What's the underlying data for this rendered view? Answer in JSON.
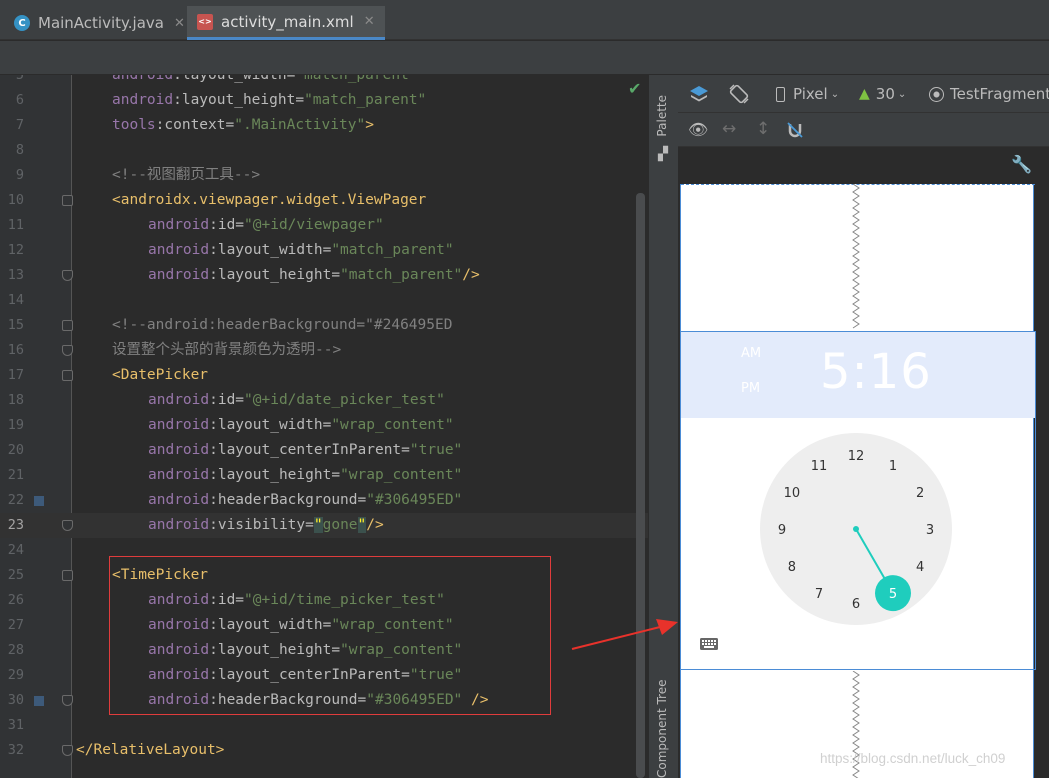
{
  "tabs": [
    {
      "label": "MainActivity.java",
      "icon": "java-class-icon",
      "active": false
    },
    {
      "label": "activity_main.xml",
      "icon": "xml-layout-icon",
      "active": true
    }
  ],
  "editor": {
    "lines": [
      {
        "num": "5",
        "indent": 1,
        "current": false,
        "parts": [
          {
            "c": "an",
            "t": "android"
          },
          {
            "c": "ak",
            "t": ":layout_width="
          },
          {
            "c": "av",
            "t": "\"match_parent\""
          }
        ]
      },
      {
        "num": "6",
        "indent": 1,
        "current": false,
        "parts": [
          {
            "c": "an",
            "t": "android"
          },
          {
            "c": "ak",
            "t": ":layout_height="
          },
          {
            "c": "av",
            "t": "\"match_parent\""
          }
        ]
      },
      {
        "num": "7",
        "indent": 1,
        "current": false,
        "parts": [
          {
            "c": "an",
            "t": "tools"
          },
          {
            "c": "ak",
            "t": ":context="
          },
          {
            "c": "av",
            "t": "\".MainActivity\""
          },
          {
            "c": "tg",
            "t": ">"
          }
        ]
      },
      {
        "num": "8",
        "indent": 0,
        "current": false,
        "parts": []
      },
      {
        "num": "9",
        "indent": 1,
        "current": false,
        "parts": [
          {
            "c": "cm",
            "t": "<!--视图翻页工具-->"
          }
        ]
      },
      {
        "num": "10",
        "indent": 1,
        "current": false,
        "fold": "open",
        "parts": [
          {
            "c": "tg",
            "t": "<androidx.viewpager.widget.ViewPager"
          }
        ]
      },
      {
        "num": "11",
        "indent": 2,
        "current": false,
        "parts": [
          {
            "c": "an",
            "t": "android"
          },
          {
            "c": "ak",
            "t": ":id="
          },
          {
            "c": "av",
            "t": "\"@+id/viewpager\""
          }
        ]
      },
      {
        "num": "12",
        "indent": 2,
        "current": false,
        "parts": [
          {
            "c": "an",
            "t": "android"
          },
          {
            "c": "ak",
            "t": ":layout_width="
          },
          {
            "c": "av",
            "t": "\"match_parent\""
          }
        ]
      },
      {
        "num": "13",
        "indent": 2,
        "current": false,
        "fold": "close",
        "parts": [
          {
            "c": "an",
            "t": "android"
          },
          {
            "c": "ak",
            "t": ":layout_height="
          },
          {
            "c": "av",
            "t": "\"match_parent\""
          },
          {
            "c": "tg",
            "t": "/>"
          }
        ]
      },
      {
        "num": "14",
        "indent": 0,
        "current": false,
        "parts": []
      },
      {
        "num": "15",
        "indent": 1,
        "current": false,
        "fold": "open",
        "parts": [
          {
            "c": "cm",
            "t": "<!--android:headerBackground=\"#246495ED"
          }
        ]
      },
      {
        "num": "16",
        "indent": 1,
        "current": false,
        "fold": "close",
        "parts": [
          {
            "c": "cm",
            "t": "设置整个头部的背景颜色为透明-->"
          }
        ]
      },
      {
        "num": "17",
        "indent": 1,
        "current": false,
        "fold": "open",
        "parts": [
          {
            "c": "tg",
            "t": "<DatePicker"
          }
        ]
      },
      {
        "num": "18",
        "indent": 2,
        "current": false,
        "parts": [
          {
            "c": "an",
            "t": "android"
          },
          {
            "c": "ak",
            "t": ":id="
          },
          {
            "c": "av",
            "t": "\"@+id/date_picker_test\""
          }
        ]
      },
      {
        "num": "19",
        "indent": 2,
        "current": false,
        "parts": [
          {
            "c": "an",
            "t": "android"
          },
          {
            "c": "ak",
            "t": ":layout_width="
          },
          {
            "c": "av",
            "t": "\"wrap_content\""
          }
        ]
      },
      {
        "num": "20",
        "indent": 2,
        "current": false,
        "parts": [
          {
            "c": "an",
            "t": "android"
          },
          {
            "c": "ak",
            "t": ":layout_centerInParent="
          },
          {
            "c": "av",
            "t": "\"true\""
          }
        ]
      },
      {
        "num": "21",
        "indent": 2,
        "current": false,
        "parts": [
          {
            "c": "an",
            "t": "android"
          },
          {
            "c": "ak",
            "t": ":layout_height="
          },
          {
            "c": "av",
            "t": "\"wrap_content\""
          }
        ]
      },
      {
        "num": "22",
        "indent": 2,
        "current": false,
        "marker": true,
        "parts": [
          {
            "c": "an",
            "t": "android"
          },
          {
            "c": "ak",
            "t": ":headerBackground="
          },
          {
            "c": "av",
            "t": "\"#306495ED\""
          }
        ]
      },
      {
        "num": "23",
        "indent": 2,
        "current": true,
        "fold": "close",
        "parts": [
          {
            "c": "an",
            "t": "android"
          },
          {
            "c": "ak",
            "t": ":visibility="
          },
          {
            "c": "hl",
            "t": "\""
          },
          {
            "c": "av",
            "t": "gone"
          },
          {
            "c": "hl",
            "t": "\""
          },
          {
            "c": "tg",
            "t": "/>"
          }
        ]
      },
      {
        "num": "24",
        "indent": 0,
        "current": false,
        "parts": []
      },
      {
        "num": "25",
        "indent": 1,
        "current": false,
        "fold": "open",
        "parts": [
          {
            "c": "tg",
            "t": "<TimePicker"
          }
        ]
      },
      {
        "num": "26",
        "indent": 2,
        "current": false,
        "parts": [
          {
            "c": "an",
            "t": "android"
          },
          {
            "c": "ak",
            "t": ":id="
          },
          {
            "c": "av",
            "t": "\"@+id/time_picker_test\""
          }
        ]
      },
      {
        "num": "27",
        "indent": 2,
        "current": false,
        "parts": [
          {
            "c": "an",
            "t": "android"
          },
          {
            "c": "ak",
            "t": ":layout_width="
          },
          {
            "c": "av",
            "t": "\"wrap_content\""
          }
        ]
      },
      {
        "num": "28",
        "indent": 2,
        "current": false,
        "parts": [
          {
            "c": "an",
            "t": "android"
          },
          {
            "c": "ak",
            "t": ":layout_height="
          },
          {
            "c": "av",
            "t": "\"wrap_content\""
          }
        ]
      },
      {
        "num": "29",
        "indent": 2,
        "current": false,
        "parts": [
          {
            "c": "an",
            "t": "android"
          },
          {
            "c": "ak",
            "t": ":layout_centerInParent="
          },
          {
            "c": "av",
            "t": "\"true\""
          }
        ]
      },
      {
        "num": "30",
        "indent": 2,
        "current": false,
        "marker": true,
        "fold": "close",
        "parts": [
          {
            "c": "an",
            "t": "android"
          },
          {
            "c": "ak",
            "t": ":headerBackground="
          },
          {
            "c": "av",
            "t": "\"#306495ED\""
          },
          {
            "c": "tx",
            "t": " "
          },
          {
            "c": "tg",
            "t": "/>"
          }
        ]
      },
      {
        "num": "31",
        "indent": 0,
        "current": false,
        "parts": []
      },
      {
        "num": "32",
        "indent": 0,
        "current": false,
        "fold": "close",
        "parts": [
          {
            "c": "tg",
            "t": "</RelativeLayout>"
          }
        ]
      }
    ]
  },
  "side_panel": {
    "palette_label": "Palette",
    "component_tree_label": "Component Tree"
  },
  "design_toolbar": {
    "device": "Pixel",
    "api_level": "30",
    "theme": "TestFragment"
  },
  "time_picker": {
    "am_label": "AM",
    "pm_label": "PM",
    "time": "5:16",
    "header_color": "#e3ebfb",
    "accent_color": "#1fcdbd",
    "face_color": "#eeeeee",
    "selected_number": "5",
    "numbers": [
      "12",
      "1",
      "2",
      "3",
      "4",
      "5",
      "6",
      "7",
      "8",
      "9",
      "10",
      "11"
    ]
  },
  "watermark": "https://blog.csdn.net/luck_ch09"
}
